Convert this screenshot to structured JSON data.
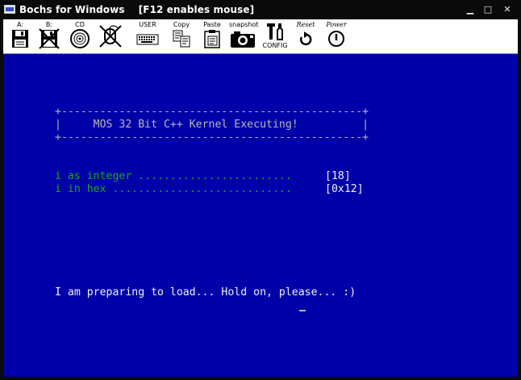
{
  "window": {
    "title": "Bochs for Windows",
    "subtitle": "[F12 enables mouse]",
    "controls": {
      "minimize": "▁",
      "maximize": "□",
      "close": "✕"
    }
  },
  "toolbar": {
    "floppy_a": "A:",
    "floppy_b": "B:",
    "cdrom": "CD",
    "user": "USER",
    "copy": "Copy",
    "paste": "Paste",
    "snapshot": "snapshot",
    "config": "CONFIG",
    "reset": "Reset",
    "power": "Power"
  },
  "console": {
    "box_top": "+-----------------------------------------------+",
    "box_middle": "|     MOS 32 Bit C++ Kernel Executing!          |",
    "box_bottom": "+-----------------------------------------------+",
    "row1_label": "i as integer ........................",
    "row1_value": "[18]",
    "row2_label": "i in hex ............................",
    "row2_value": "[0x12]",
    "message": "I am preparing to load... Hold on, please... :)"
  },
  "colors": {
    "screen_bg": "#0000a8",
    "text_grey": "#b8b8b8",
    "text_green": "#18a818",
    "text_white": "#f0f0f0"
  }
}
